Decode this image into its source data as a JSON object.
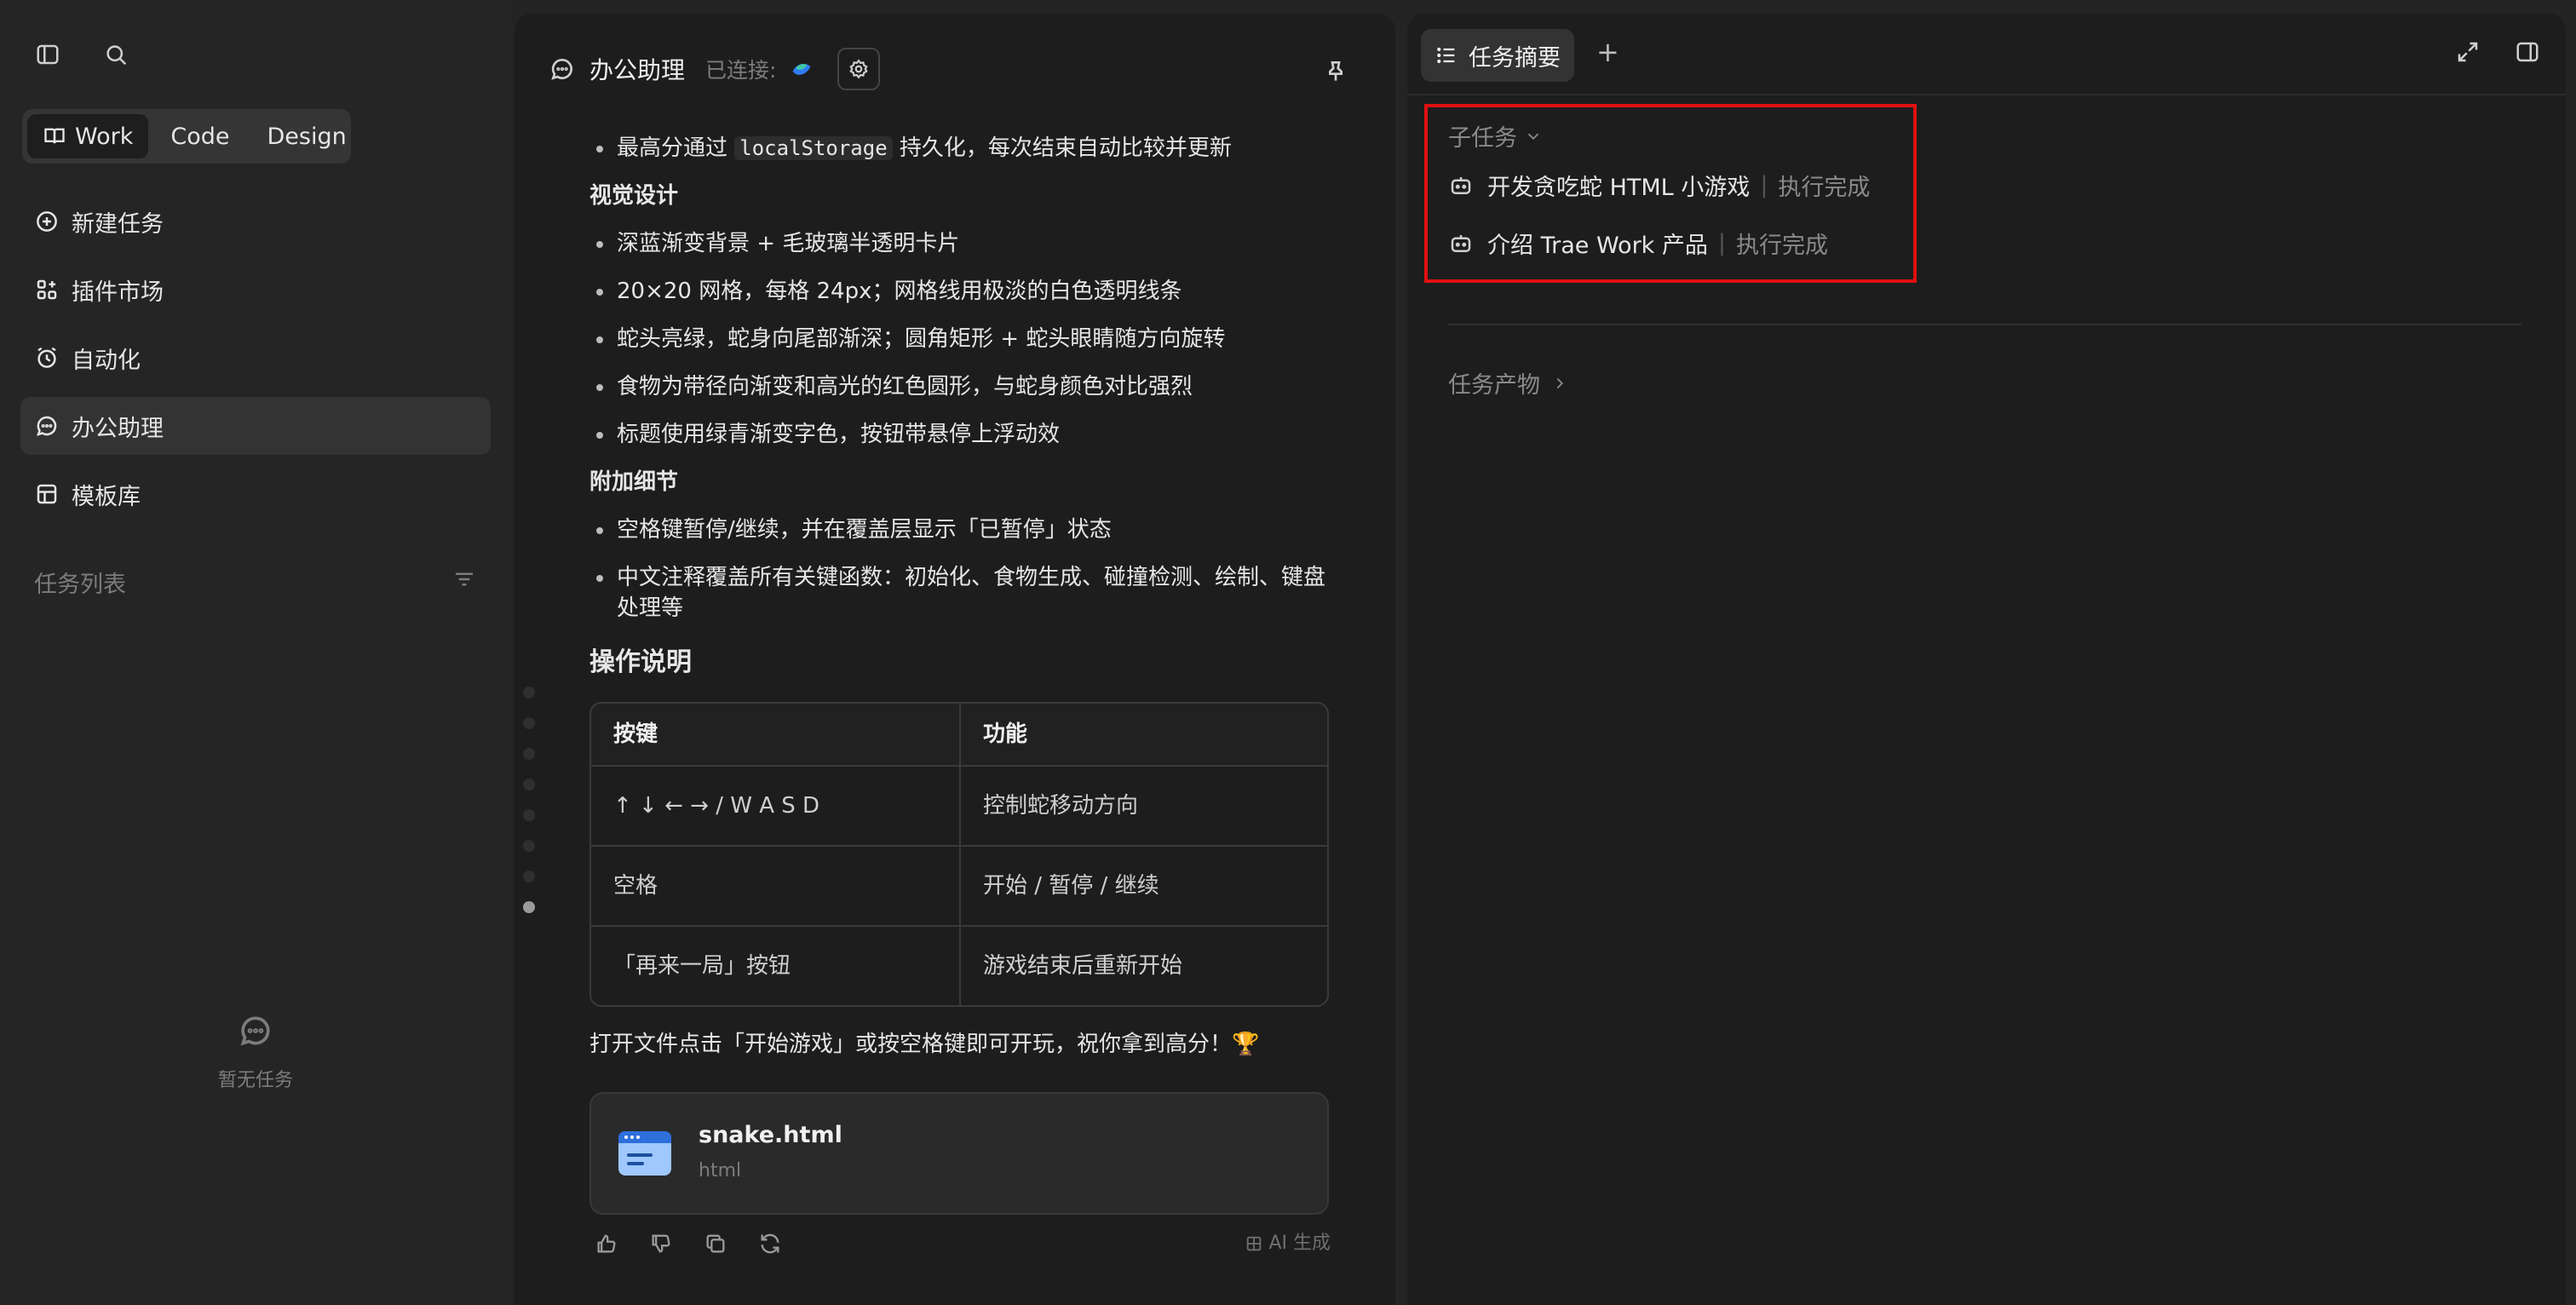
{
  "sidebar": {
    "modes": [
      {
        "label": "Work",
        "active": true
      },
      {
        "label": "Code",
        "active": false
      },
      {
        "label": "Design",
        "active": false
      }
    ],
    "nav": [
      {
        "label": "新建任务",
        "icon": "plus-circle-icon",
        "active": false
      },
      {
        "label": "插件市场",
        "icon": "grid-plus-icon",
        "active": false
      },
      {
        "label": "自动化",
        "icon": "clock-icon",
        "active": false
      },
      {
        "label": "办公助理",
        "icon": "chat-bubble-icon",
        "active": true
      },
      {
        "label": "模板库",
        "icon": "template-icon",
        "active": false
      }
    ],
    "task_list_title": "任务列表",
    "empty_text": "暂无任务"
  },
  "chat": {
    "title": "办公助理",
    "connected_label": "已连接:",
    "bullets_top": [
      {
        "pre": "最高分通过 ",
        "code": "localStorage",
        "post": " 持久化，每次结束自动比较并更新"
      }
    ],
    "visual_design": {
      "title": "视觉设计",
      "items": [
        "深蓝渐变背景 + 毛玻璃半透明卡片",
        "20×20 网格，每格 24px；网格线用极淡的白色透明线条",
        "蛇头亮绿，蛇身向尾部渐深；圆角矩形 + 蛇头眼睛随方向旋转",
        "食物为带径向渐变和高光的红色圆形，与蛇身颜色对比强烈",
        "标题使用绿青渐变字色，按钮带悬停上浮动效"
      ]
    },
    "extra_details": {
      "title": "附加细节",
      "items": [
        "空格键暂停/继续，并在覆盖层显示「已暂停」状态",
        "中文注释覆盖所有关键函数：初始化、食物生成、碰撞检测、绘制、键盘处理等"
      ]
    },
    "operation": {
      "title": "操作说明",
      "headers": [
        "按键",
        "功能"
      ],
      "rows": [
        [
          "↑ ↓ ← → / W A S D",
          "控制蛇移动方向"
        ],
        [
          "空格",
          "开始 / 暂停 / 继续"
        ],
        [
          "「再来一局」按钮",
          "游戏结束后重新开始"
        ]
      ]
    },
    "closing": "打开文件点击「开始游戏」或按空格键即可开玩，祝你拿到高分！🏆",
    "file": {
      "name": "snake.html",
      "type": "html"
    },
    "ai_generated": "AI 生成"
  },
  "right": {
    "tab_label": "任务摘要",
    "subtasks_title": "子任务",
    "subtasks": [
      {
        "name": "开发贪吃蛇 HTML 小游戏",
        "status": "执行完成"
      },
      {
        "name": "介绍 Trae Work 产品",
        "status": "执行完成"
      }
    ],
    "artifacts_title": "任务产物"
  }
}
